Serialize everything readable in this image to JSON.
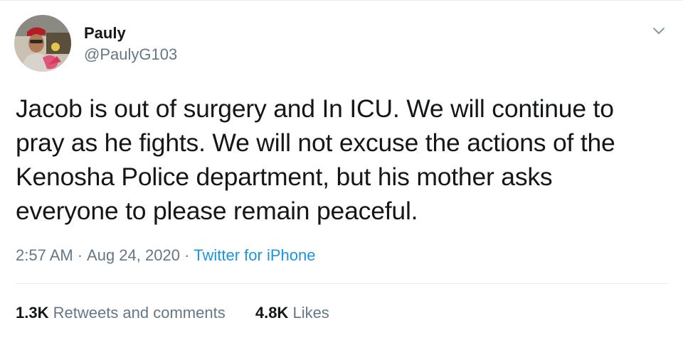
{
  "tweet": {
    "author": {
      "display_name": "Pauly",
      "handle": "@PaulyG103",
      "avatar_icon": "profile-photo"
    },
    "menu_icon": "chevron-down-icon",
    "text_lines": [
      "Jacob is out of surgery and In ICU. We will continue to",
      "pray as he fights. We will not excuse the actions of the",
      "Kenosha Police department, but his mother asks",
      "everyone to please remain peaceful."
    ],
    "time": "2:57 AM",
    "separator": "·",
    "date": "Aug 24, 2020",
    "source": "Twitter for iPhone",
    "stats": {
      "retweets_count": "1.3K",
      "retweets_label": "Retweets and comments",
      "likes_count": "4.8K",
      "likes_label": "Likes"
    },
    "colors": {
      "link": "#1b95e0",
      "secondary": "#657786",
      "primary": "#14171a",
      "divider": "#e6ecf0"
    }
  }
}
